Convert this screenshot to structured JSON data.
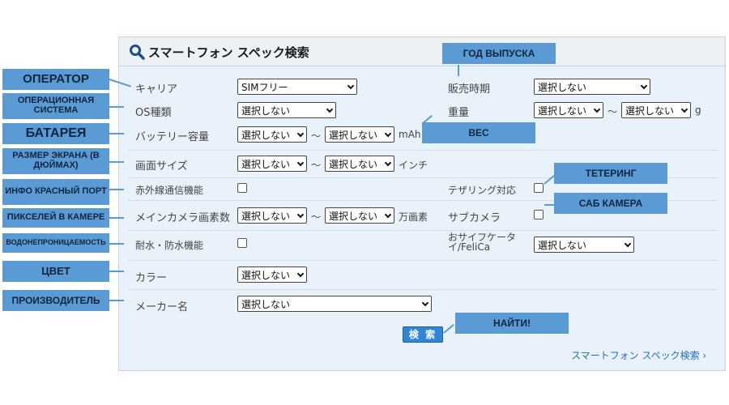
{
  "panel": {
    "title": "スマートフォン スペック検索",
    "search_button": "検 索",
    "footer_link": "スマートフォン スペック検索 ›"
  },
  "form": {
    "carrier": {
      "label": "キャリア",
      "value": "SIMフリー"
    },
    "release": {
      "label": "販売時期",
      "value": "選択しない"
    },
    "os": {
      "label": "OS種類",
      "value": "選択しない"
    },
    "weight": {
      "label": "重量",
      "min": "選択しない",
      "max": "選択しない",
      "unit": "g"
    },
    "battery": {
      "label": "バッテリー容量",
      "min": "選択しない",
      "max": "選択しない",
      "unit": "mAh"
    },
    "screen": {
      "label": "画面サイズ",
      "min": "選択しない",
      "max": "選択しない",
      "unit": "インチ"
    },
    "infrared": {
      "label": "赤外線通信機能"
    },
    "tethering": {
      "label": "テザリング対応"
    },
    "camera": {
      "label": "メインカメラ画素数",
      "min": "選択しない",
      "max": "選択しない",
      "unit": "万画素"
    },
    "subcamera": {
      "label": "サブカメラ"
    },
    "waterproof": {
      "label": "耐水・防水機能"
    },
    "osaifu": {
      "label": "おサイフケータイ/FeliCa",
      "value": "選択しない"
    },
    "color": {
      "label": "カラー",
      "value": "選択しない"
    },
    "maker": {
      "label": "メーカー名",
      "value": "選択しない"
    },
    "range_sep": "～"
  },
  "callouts": {
    "operator": "ОПЕРАТОР",
    "os": "ОПЕРАЦИОННАЯ СИСТЕМА",
    "battery": "БАТАРЕЯ",
    "screen": "РАЗМЕР ЭКРАНА (В ДЮЙМАХ)",
    "infrared": "ИНФО КРАСНЫЙ ПОРТ",
    "camera": "ПИКСЕЛЕЙ В КАМЕРЕ",
    "waterproof": "ВОДОНЕПРОНИЦАЕМОСТЬ",
    "color": "ЦВЕТ",
    "maker": "ПРОИЗВОДИТЕЛЬ",
    "release": "ГОД ВЫПУСКА",
    "weight": "ВЕС",
    "tethering": "ТЕТЕРИНГ",
    "subcamera": "САБ КАМЕРА",
    "find": "НАЙТИ!"
  },
  "colors": {
    "callout": "#5b9bd5",
    "button": "#2f86d9",
    "panel_bg": "#e9f2fb"
  }
}
